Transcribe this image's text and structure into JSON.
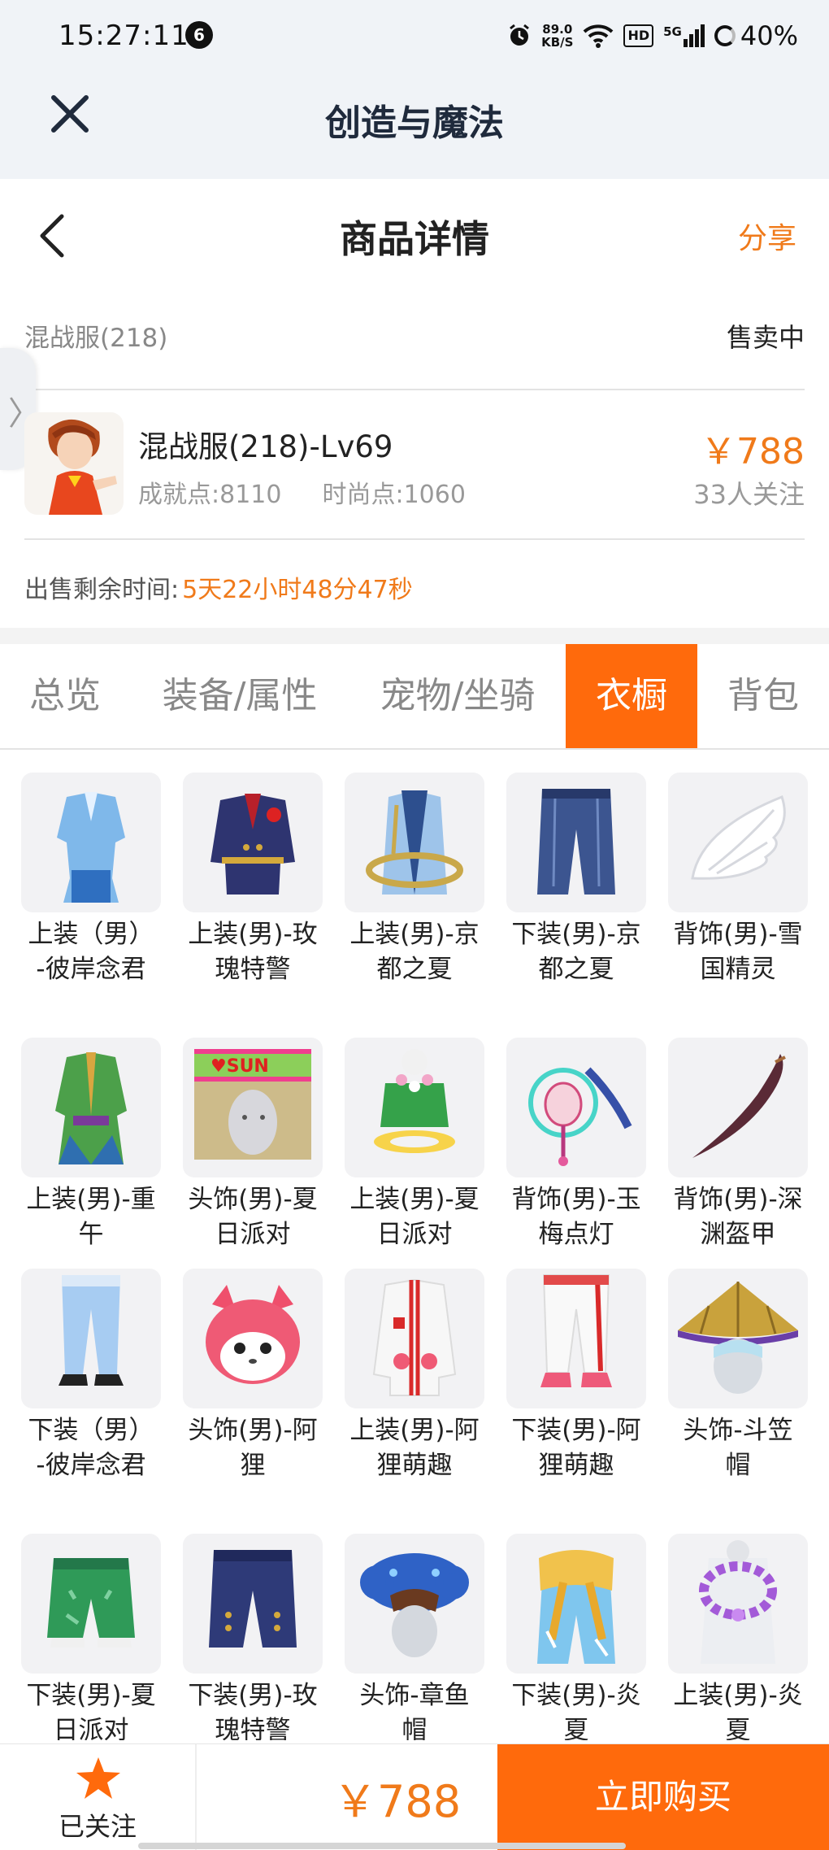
{
  "status_bar": {
    "time": "15:27:11",
    "notification_count": "6",
    "net_speed_value": "89.0",
    "net_speed_unit": "KB/S",
    "hd_label": "HD",
    "signal_label": "5G",
    "battery": "40%"
  },
  "app_header": {
    "title": "创造与魔法"
  },
  "page_header": {
    "title": "商品详情",
    "share": "分享"
  },
  "listing": {
    "server": "混战服(218)",
    "status": "售卖中",
    "character_name": "混战服(218)-Lv69",
    "achievement": "成就点:8110",
    "fashion": "时尚点:1060",
    "price": "￥788",
    "followers": "33人关注",
    "remaining_label": "出售剩余时间:",
    "remaining_value": "5天22小时48分47秒"
  },
  "tabs": [
    {
      "label": "总览",
      "active": false
    },
    {
      "label": "装备/属性",
      "active": false
    },
    {
      "label": "宠物/坐骑",
      "active": false
    },
    {
      "label": "衣橱",
      "active": true
    },
    {
      "label": "背包",
      "active": false
    }
  ],
  "wardrobe": [
    {
      "label": "上装（男）-彼岸念君",
      "icon": "light-blue-top"
    },
    {
      "label": "上装(男)-玫瑰特警",
      "icon": "navy-uniform-jacket"
    },
    {
      "label": "上装(男)-京都之夏",
      "icon": "kyoto-summer-top"
    },
    {
      "label": "下装(男)-京都之夏",
      "icon": "navy-pants"
    },
    {
      "label": "背饰(男)-雪国精灵",
      "icon": "white-wing"
    },
    {
      "label": "上装(男)-重午",
      "icon": "green-robe"
    },
    {
      "label": "头饰(男)-夏日派对",
      "icon": "straw-hat"
    },
    {
      "label": "上装(男)-夏日派对",
      "icon": "party-top"
    },
    {
      "label": "背饰(男)-玉梅点灯",
      "icon": "lantern"
    },
    {
      "label": "背饰(男)-深渊盔甲",
      "icon": "dark-blade"
    },
    {
      "label": "下装（男）-彼岸念君",
      "icon": "light-blue-pants"
    },
    {
      "label": "头饰(男)-阿狸",
      "icon": "fox-head"
    },
    {
      "label": "上装(男)-阿狸萌趣",
      "icon": "white-red-jacket"
    },
    {
      "label": "下装(男)-阿狸萌趣",
      "icon": "white-pants"
    },
    {
      "label": "头饰-斗笠帽",
      "icon": "bamboo-hat"
    },
    {
      "label": "下装(男)-夏日派对",
      "icon": "green-shorts"
    },
    {
      "label": "下装(男)-玫瑰特警",
      "icon": "navy-shorts"
    },
    {
      "label": "头饰-章鱼帽",
      "icon": "octopus-hat"
    },
    {
      "label": "下装(男)-炎夏",
      "icon": "yellow-sash-pants"
    },
    {
      "label": "上装(男)-炎夏",
      "icon": "flower-lei"
    }
  ],
  "colors": {
    "accent": "#ff6a0c",
    "price": "#f07a1a"
  },
  "bottom_bar": {
    "follow_label": "已关注",
    "price": "￥788",
    "buy_label": "立即购买"
  }
}
